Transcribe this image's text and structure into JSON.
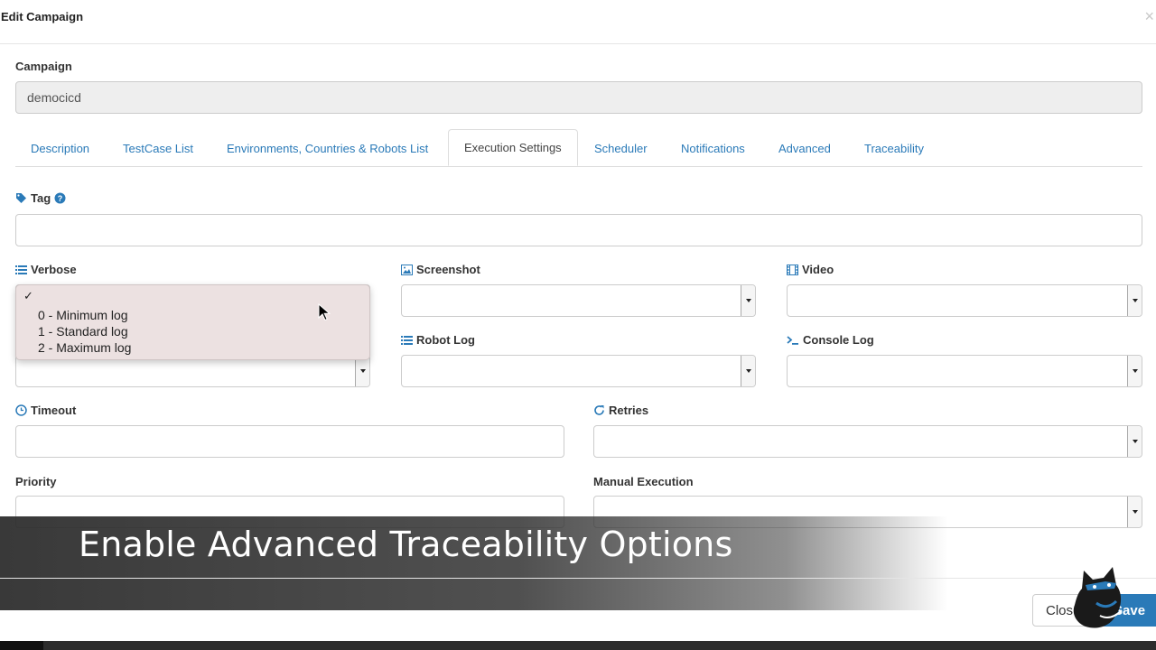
{
  "modal": {
    "title": "Edit Campaign",
    "close_glyph": "×"
  },
  "campaign": {
    "label": "Campaign",
    "value": "democicd"
  },
  "tabs": [
    {
      "label": "Description",
      "active": false
    },
    {
      "label": "TestCase List",
      "active": false
    },
    {
      "label": "Environments, Countries & Robots List",
      "active": false
    },
    {
      "label": "Execution Settings",
      "active": true
    },
    {
      "label": "Scheduler",
      "active": false
    },
    {
      "label": "Notifications",
      "active": false
    },
    {
      "label": "Advanced",
      "active": false
    },
    {
      "label": "Traceability",
      "active": false
    }
  ],
  "fields": {
    "tag": {
      "label": "Tag",
      "value": "",
      "icon": "tag-icon",
      "help_icon": "question-circle-icon"
    },
    "verbose": {
      "label": "Verbose",
      "icon": "list-icon",
      "value": ""
    },
    "screenshot": {
      "label": "Screenshot",
      "icon": "image-icon",
      "value": ""
    },
    "video": {
      "label": "Video",
      "icon": "film-icon",
      "value": ""
    },
    "robot_log": {
      "label": "Robot Log",
      "icon": "list-icon",
      "value": ""
    },
    "console_log": {
      "label": "Console Log",
      "icon": "terminal-icon",
      "value": ""
    },
    "timeout": {
      "label": "Timeout",
      "icon": "clock-icon",
      "value": ""
    },
    "retries": {
      "label": "Retries",
      "icon": "refresh-icon",
      "value": ""
    },
    "priority": {
      "label": "Priority",
      "value": ""
    },
    "manual_execution": {
      "label": "Manual Execution",
      "value": ""
    }
  },
  "verbose_dropdown": {
    "check_glyph": "✓",
    "options": [
      "0 - Minimum log",
      "1 - Standard log",
      "2 - Maximum log"
    ]
  },
  "overlay": {
    "caption": "Enable Advanced Traceability Options"
  },
  "footer": {
    "close_label": "Clos",
    "save_label": "Save"
  },
  "colors": {
    "accent": "#2a7ab8",
    "dropdown_bg": "#ece1e1",
    "overlay": "#333333"
  }
}
